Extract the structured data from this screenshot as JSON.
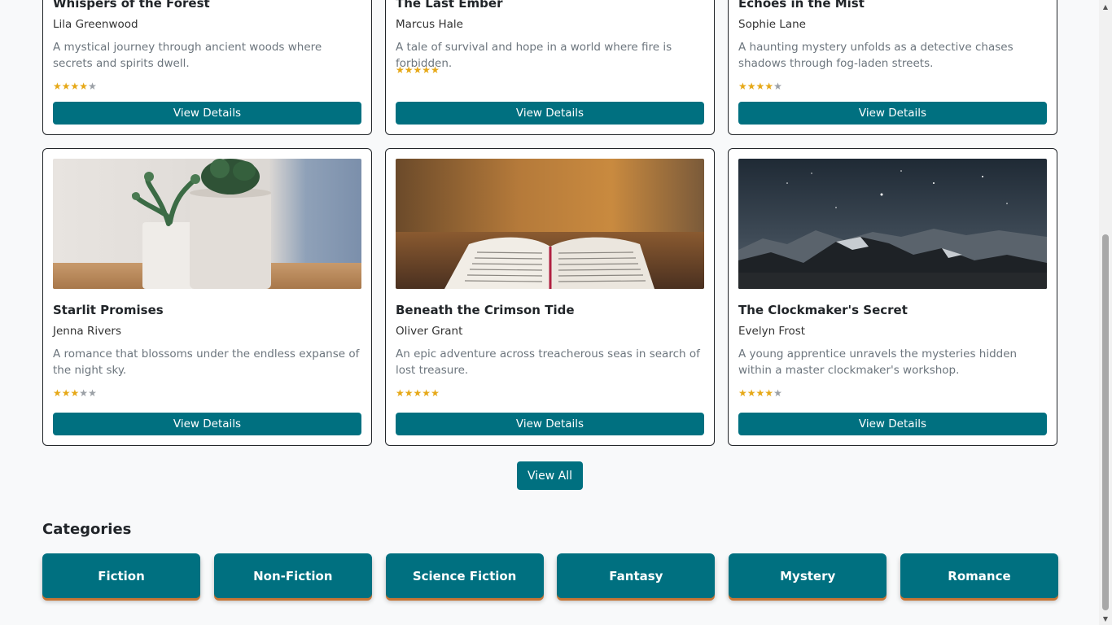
{
  "books_top": [
    {
      "title": "Whispers of the Forest",
      "author": "Lila Greenwood",
      "description": "A mystical journey through ancient woods where secrets and spirits dwell.",
      "rating": 4,
      "button": "View Details"
    },
    {
      "title": "The Last Ember",
      "author": "Marcus Hale",
      "description": "A tale of survival and hope in a world where fire is forbidden.",
      "rating": 5,
      "button": "View Details"
    },
    {
      "title": "Echoes in the Mist",
      "author": "Sophie Lane",
      "description": "A haunting mystery unfolds as a detective chases shadows through fog-laden streets.",
      "rating": 4,
      "button": "View Details"
    }
  ],
  "books_bottom": [
    {
      "title": "Starlit Promises",
      "author": "Jenna Rivers",
      "description": "A romance that blossoms under the endless expanse of the night sky.",
      "rating": 3,
      "button": "View Details",
      "image": "potted-plants"
    },
    {
      "title": "Beneath the Crimson Tide",
      "author": "Oliver Grant",
      "description": "An epic adventure across treacherous seas in search of lost treasure.",
      "rating": 5,
      "button": "View Details",
      "image": "open-book"
    },
    {
      "title": "The Clockmaker's Secret",
      "author": "Evelyn Frost",
      "description": "A young apprentice unravels the mysteries hidden within a master clockmaker's workshop.",
      "rating": 4,
      "button": "View Details",
      "image": "mountain-night-sky"
    }
  ],
  "rating_max": 5,
  "view_all_label": "View All",
  "categories_heading": "Categories",
  "categories": [
    "Fiction",
    "Non-Fiction",
    "Science Fiction",
    "Fantasy",
    "Mystery",
    "Romance"
  ],
  "colors": {
    "accent": "#007080",
    "star": "#e6a817",
    "star_empty": "#9ba0a6",
    "category_shadow": "#c87533"
  }
}
